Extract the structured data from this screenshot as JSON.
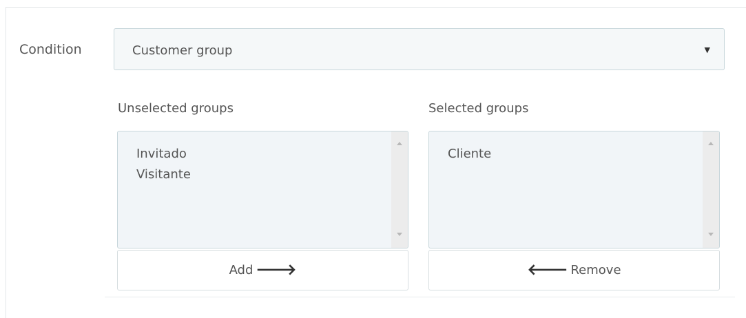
{
  "condition": {
    "label": "Condition",
    "selected": "Customer group",
    "caret": "▼"
  },
  "unselected": {
    "label": "Unselected groups",
    "items": [
      "Invitado",
      "Visitante"
    ]
  },
  "selected": {
    "label": "Selected groups",
    "items": [
      "Cliente"
    ]
  },
  "buttons": {
    "add_label": "Add",
    "add_arrow": "🡒",
    "remove_label": "Remove",
    "remove_arrow": "🡐"
  }
}
